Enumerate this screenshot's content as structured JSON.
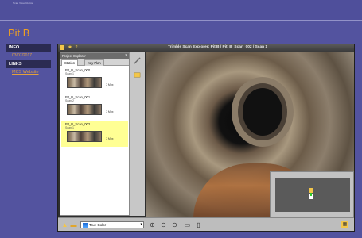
{
  "header": {
    "logo_text": "Scan Visualization"
  },
  "page": {
    "title": "Pit B"
  },
  "sidebar": {
    "info_label": "INFO",
    "date": "03/07/2017",
    "links_label": "LINKS",
    "link_text": "MCS Website"
  },
  "viewer": {
    "title": "Trimble Scan Explorer: Pit B / Pit_B_Scan_002 / Scan 1",
    "explorer": {
      "header": "Project Explorer",
      "tabs": [
        "Station",
        "Key Plan"
      ],
      "scans": [
        {
          "name": "Pit_B_Scan_000",
          "sub": "Scan 1",
          "size": "7 Mpx",
          "selected": false
        },
        {
          "name": "Pit_B_Scan_001",
          "sub": "Scan 2",
          "size": "7 Mpx",
          "selected": false
        },
        {
          "name": "Pit_B_Scan_002",
          "sub": "Scan 1",
          "size": "7 Mpx",
          "selected": true
        }
      ]
    },
    "bottom": {
      "color_mode": "True Color"
    }
  },
  "colors": {
    "accent": "#f0a020",
    "background": "#53539f",
    "selection": "#ffff94"
  }
}
